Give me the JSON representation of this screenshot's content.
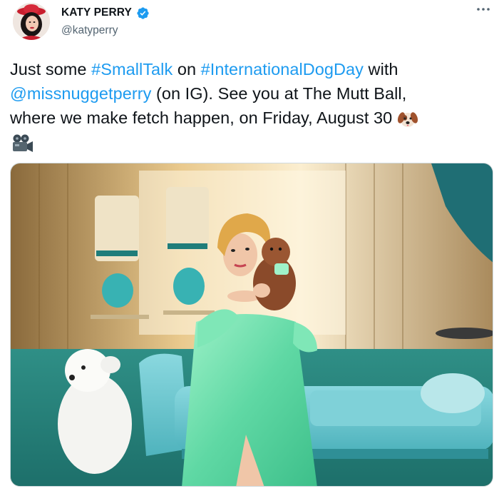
{
  "author": {
    "display_name": "KATY PERRY",
    "handle": "@katyperry",
    "verified": true,
    "avatar_icon": "profile-avatar"
  },
  "more_icon": "more-horizontal-icon",
  "tweet": {
    "lines": [
      [
        {
          "t": "Just some ",
          "link": false
        },
        {
          "t": "#SmallTalk",
          "link": true
        },
        {
          "t": " on ",
          "link": false
        },
        {
          "t": "#InternationalDogDay",
          "link": true
        },
        {
          "t": " with",
          "link": false
        }
      ],
      [
        {
          "t": "@missnuggetperry",
          "link": true
        },
        {
          "t": " (on IG). See you at The Mutt Ball,",
          "link": false
        }
      ],
      [
        {
          "t": "where we make fetch happen, on Friday, August 30 ",
          "link": false
        }
      ]
    ],
    "emojis": [
      "dog-face-emoji",
      "movie-camera-emoji"
    ]
  },
  "colors": {
    "link": "#1d9bf0",
    "text": "#0f1419",
    "secondary": "#536471",
    "verified": "#1d9bf0"
  },
  "media": {
    "type": "photo",
    "subject": "photo-woman-mint-gown-with-small-dog-on-teal-chaise"
  }
}
